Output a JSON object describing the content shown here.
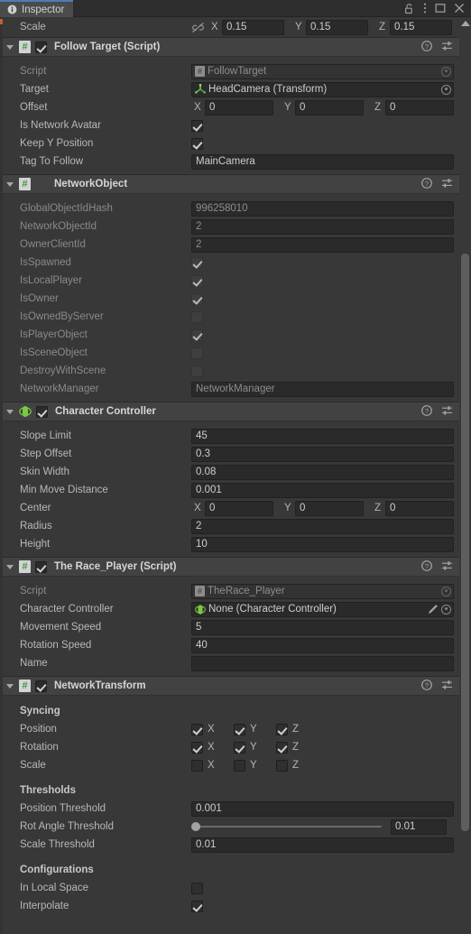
{
  "window": {
    "tab_label": "Inspector",
    "tab_icon": "info-icon",
    "lock_icon": "lock-open-icon",
    "menu_icon": "kebab-menu-icon",
    "maximize_icon": "maximize-icon",
    "close_icon": "close-icon"
  },
  "transform_scale": {
    "label": "Scale",
    "constraint_icon": "broken-link-icon",
    "x_axis": "X",
    "x_value": "0.15",
    "y_axis": "Y",
    "y_value": "0.15",
    "z_axis": "Z",
    "z_value": "0.15"
  },
  "header_icons": {
    "help": "help-icon",
    "preset": "preset-sliders-icon",
    "more": "kebab-menu-icon"
  },
  "components": [
    {
      "title": "Follow Target (Script)",
      "icon": "csharp-script-icon",
      "enabled": true,
      "has_enable_toggle": true,
      "rows": [
        {
          "type": "object",
          "label": "Script",
          "dim": true,
          "readonly": true,
          "icon": "csharp-script-mini-icon",
          "value": "FollowTarget"
        },
        {
          "type": "object",
          "label": "Target",
          "dim": false,
          "readonly": false,
          "icon": "transform-axis-icon",
          "value": "HeadCamera (Transform)"
        },
        {
          "type": "vector3",
          "label": "Offset",
          "x_axis": "X",
          "x": "0",
          "y_axis": "Y",
          "y": "0",
          "z_axis": "Z",
          "z": "0"
        },
        {
          "type": "checkbox",
          "label": "Is Network Avatar",
          "checked": true
        },
        {
          "type": "checkbox",
          "label": "Keep Y Position",
          "checked": true
        },
        {
          "type": "text",
          "label": "Tag To Follow",
          "value": "MainCamera"
        }
      ]
    },
    {
      "title": "NetworkObject",
      "icon": "csharp-script-icon",
      "enabled": false,
      "has_enable_toggle": false,
      "rows": [
        {
          "type": "text",
          "label": "GlobalObjectIdHash",
          "dim": true,
          "readonly": true,
          "value": "996258010"
        },
        {
          "type": "text",
          "label": "NetworkObjectId",
          "dim": true,
          "readonly": true,
          "value": "2"
        },
        {
          "type": "text",
          "label": "OwnerClientId",
          "dim": true,
          "readonly": true,
          "value": "2"
        },
        {
          "type": "checkbox",
          "label": "IsSpawned",
          "dim": true,
          "checked": true,
          "lite": true
        },
        {
          "type": "checkbox",
          "label": "IsLocalPlayer",
          "dim": true,
          "checked": true,
          "lite": true
        },
        {
          "type": "checkbox",
          "label": "IsOwner",
          "dim": true,
          "checked": true,
          "lite": true
        },
        {
          "type": "checkbox",
          "label": "IsOwnedByServer",
          "dim": true,
          "checked": false,
          "lite": true
        },
        {
          "type": "checkbox",
          "label": "IsPlayerObject",
          "dim": true,
          "checked": true,
          "lite": true
        },
        {
          "type": "checkbox",
          "label": "IsSceneObject",
          "dim": true,
          "checked": false,
          "lite": true
        },
        {
          "type": "checkbox",
          "label": "DestroyWithScene",
          "dim": true,
          "checked": false,
          "lite": true
        },
        {
          "type": "text",
          "label": "NetworkManager",
          "dim": true,
          "readonly": true,
          "value": "NetworkManager"
        }
      ]
    },
    {
      "title": "Character Controller",
      "icon": "character-controller-icon",
      "enabled": true,
      "has_enable_toggle": true,
      "rows": [
        {
          "type": "text",
          "label": "Slope Limit",
          "value": "45"
        },
        {
          "type": "text",
          "label": "Step Offset",
          "value": "0.3"
        },
        {
          "type": "text",
          "label": "Skin Width",
          "value": "0.08"
        },
        {
          "type": "text",
          "label": "Min Move Distance",
          "value": "0.001"
        },
        {
          "type": "vector3",
          "label": "Center",
          "x_axis": "X",
          "x": "0",
          "y_axis": "Y",
          "y": "0",
          "z_axis": "Z",
          "z": "0"
        },
        {
          "type": "text",
          "label": "Radius",
          "value": "2"
        },
        {
          "type": "text",
          "label": "Height",
          "value": "10"
        }
      ]
    },
    {
      "title": "The Race_Player (Script)",
      "icon": "csharp-script-icon",
      "enabled": true,
      "has_enable_toggle": true,
      "rows": [
        {
          "type": "object",
          "label": "Script",
          "dim": true,
          "readonly": true,
          "icon": "csharp-script-mini-icon",
          "value": "TheRace_Player"
        },
        {
          "type": "object",
          "label": "Character Controller",
          "dim": false,
          "readonly": false,
          "icon": "character-controller-mini-icon",
          "value": "None (Character Controller)",
          "has_pencil": true
        },
        {
          "type": "text",
          "label": "Movement Speed",
          "value": "5"
        },
        {
          "type": "text",
          "label": "Rotation Speed",
          "value": "40"
        },
        {
          "type": "text",
          "label": "Name",
          "value": ""
        }
      ]
    },
    {
      "title": "NetworkTransform",
      "icon": "csharp-script-icon",
      "enabled": true,
      "has_enable_toggle": true,
      "rows": [
        {
          "type": "section",
          "label": "Syncing"
        },
        {
          "type": "xyz",
          "label": "Position",
          "x_axis": "X",
          "y_axis": "Y",
          "z_axis": "Z",
          "x": true,
          "y": true,
          "z": true
        },
        {
          "type": "xyz",
          "label": "Rotation",
          "x_axis": "X",
          "y_axis": "Y",
          "z_axis": "Z",
          "x": true,
          "y": true,
          "z": true
        },
        {
          "type": "xyz",
          "label": "Scale",
          "x_axis": "X",
          "y_axis": "Y",
          "z_axis": "Z",
          "x": false,
          "y": false,
          "z": false
        },
        {
          "type": "gap"
        },
        {
          "type": "section",
          "label": "Thresholds"
        },
        {
          "type": "text",
          "label": "Position Threshold",
          "value": "0.001"
        },
        {
          "type": "slider",
          "label": "Rot Angle Threshold",
          "value": "0.01",
          "fill": 0
        },
        {
          "type": "text",
          "label": "Scale Threshold",
          "value": "0.01"
        },
        {
          "type": "gap"
        },
        {
          "type": "section",
          "label": "Configurations"
        },
        {
          "type": "checkbox",
          "label": "In Local Space",
          "checked": false
        },
        {
          "type": "checkbox",
          "label": "Interpolate",
          "checked": true
        }
      ]
    }
  ],
  "colors": {
    "panel_bg": "#383838",
    "header_bg": "#424242",
    "field_bg": "#2a2a2a",
    "accent_tab": "#4a7dbb",
    "script_green": "#3a9b3a",
    "capsule_green": "#7ac943"
  }
}
